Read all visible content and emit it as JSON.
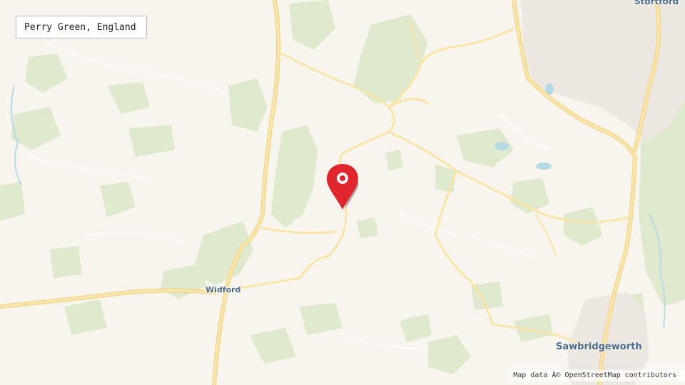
{
  "map": {
    "location_title": "Perry Green, England",
    "places": {
      "widford": "Widford",
      "sawbridgeworth": "Sawbridgeworth",
      "stortford": "Stortford"
    },
    "attribution": "Map data Â© OpenStreetMap contributors",
    "marker_icon": "map-pin-icon",
    "colors": {
      "land": "#f8f5ef",
      "woodland": "#dfe9cd",
      "water": "#b6d9e6",
      "road": "#fae5a6",
      "road_outline": "#ecd28a",
      "urban": "#ece7e0",
      "marker": "#e0252c"
    }
  }
}
